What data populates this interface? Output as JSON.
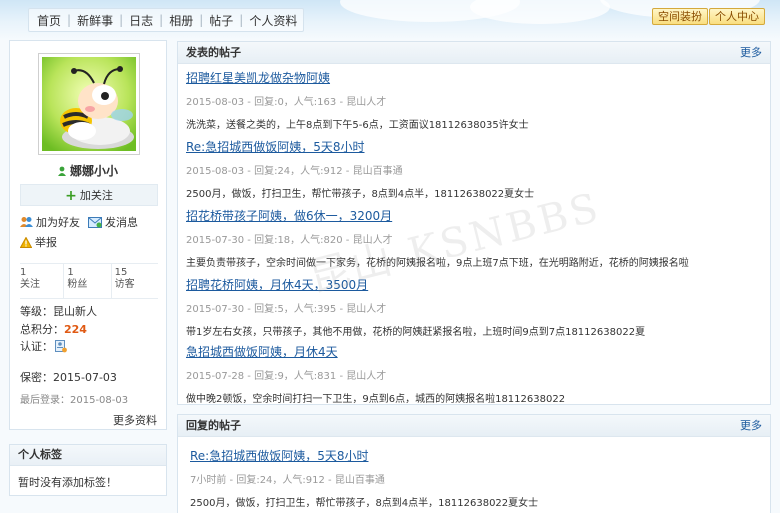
{
  "nav": {
    "items": [
      "首页",
      "新鲜事",
      "日志",
      "相册",
      "帖子",
      "个人资料"
    ],
    "separator": "|",
    "space_decorate_label": "空间装扮",
    "personal_center_label": "个人中心"
  },
  "profile": {
    "username": "娜娜小小",
    "follow_label": "加关注",
    "add_friend_label": "加为好友",
    "send_message_label": "发消息",
    "report_label": "举报",
    "stats": [
      {
        "count": "1",
        "label": "关注"
      },
      {
        "count": "1",
        "label": "粉丝"
      },
      {
        "count": "15",
        "label": "访客"
      }
    ],
    "level_label": "等级：",
    "level_value": "昆山新人",
    "points_label": "总积分：",
    "points_value": "224",
    "verify_label": "认证：",
    "birthday_label": "保密：",
    "birthday_value": "2015-07-03",
    "last_login_label": "最后登录：",
    "last_login_value": "2015-08-03",
    "more_info_label": "更多资料"
  },
  "tags": {
    "title": "个人标签",
    "empty_text": "暂时没有添加标签！"
  },
  "posted": {
    "title": "发表的帖子",
    "more_label": "更多",
    "posts": [
      {
        "title": "招聘红星美凯龙做杂物阿姨",
        "meta": "2015-08-03 - 回复:0，人气:163 - 昆山人才",
        "excerpt": "洗洗菜，送餐之类的，上午8点到下午5-6点，工资面议18112638035许女士"
      },
      {
        "title": "Re:急招城西做饭阿姨，5天8小时",
        "meta": "2015-08-03 - 回复:24，人气:912 - 昆山百事通",
        "excerpt": "2500月，做饭，打扫卫生，帮忙带孩子，8点到4点半，18112638022夏女士"
      },
      {
        "title": "招花桥带孩子阿姨，做6休一，3200月",
        "meta": "2015-07-30 - 回复:18，人气:820 - 昆山人才",
        "excerpt": "主要负责带孩子，空余时间做一下家务，花桥的阿姨报名啦，9点上班7点下班，在光明路附近，花桥的阿姨报名啦"
      },
      {
        "title": "招聘花桥阿姨，月休4天，3500月",
        "meta": "2015-07-30 - 回复:5，人气:395 - 昆山人才",
        "excerpt": "带1岁左右女孩，只带孩子，其他不用做，花桥的阿姨赶紧报名啦，上班时间9点到7点18112638022夏"
      },
      {
        "title": "急招城西做饭阿姨，月休4天",
        "meta": "2015-07-28 - 回复:9，人气:831 - 昆山人才",
        "excerpt": "做中晚2顿饭，空余时间打扫一下卫生，9点到6点，城西的阿姨报名啦18112638022"
      }
    ]
  },
  "replied": {
    "title": "回复的帖子",
    "more_label": "更多",
    "posts": [
      {
        "title": "Re:急招城西做饭阿姨，5天8小时",
        "meta": "7小时前 - 回复:24，人气:912 - 昆山百事通",
        "excerpt": "2500月，做饭，打扫卫生，帮忙带孩子，8点到4点半，18112638022夏女士"
      }
    ]
  },
  "watermark_text": "昆山 KSNBBS"
}
